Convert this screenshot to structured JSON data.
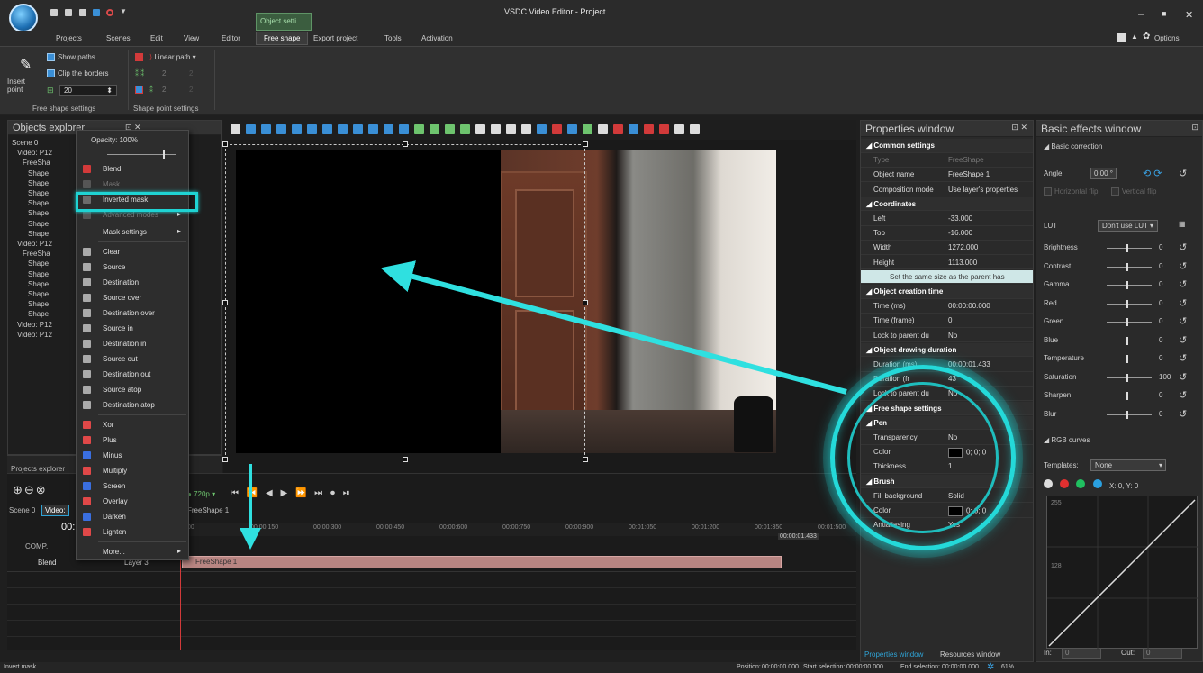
{
  "window": {
    "title": "VSDC Video Editor - Project",
    "minimize": "–",
    "maximize": "■",
    "close": "✕"
  },
  "menu": {
    "items": [
      "Projects",
      "Scenes",
      "Edit",
      "View",
      "Editor",
      "Free shape",
      "Export project",
      "Tools",
      "Activation"
    ],
    "active": "Free shape",
    "context_tab": "Object setti...",
    "options": "Options"
  },
  "ribbon": {
    "insert_point": "Insert point",
    "show_paths": "Show paths",
    "clip_borders": "Clip the borders",
    "size_value": "20",
    "linear_path": "Linear path",
    "num2a": "2",
    "num2b": "2",
    "num2c": "2",
    "num2d": "2",
    "group1": "Free shape settings",
    "group2": "Shape point settings"
  },
  "objects_explorer": {
    "title": "Objects explorer",
    "tree": [
      "Scene 0",
      "Video: P12",
      "FreeSha",
      "Shape",
      "Shape",
      "Shape",
      "Shape",
      "Shape",
      "Shape",
      "Shape",
      "Video: P12",
      "FreeSha",
      "Shape",
      "Shape",
      "Shape",
      "Shape",
      "Shape",
      "Shape",
      "Video: P12",
      "Video: P12"
    ]
  },
  "context_menu": {
    "opacity": "Opacity: 100%",
    "items": [
      {
        "label": "Blend",
        "icon": "blend-icon",
        "color": "#d23a3a"
      },
      {
        "label": "Mask",
        "icon": "mask-icon",
        "color": "#555555",
        "disabled": true
      },
      {
        "label": "Inverted mask",
        "icon": "inverted-mask-icon",
        "color": "#6c6c6c"
      },
      {
        "label": "Advanced modes",
        "icon": "advanced-icon",
        "color": "#555555",
        "disabled": true
      },
      {
        "label": "Mask settings",
        "icon": "",
        "color": ""
      },
      {
        "label": "Clear",
        "icon": "clear-icon",
        "color": "#aaaaaa"
      },
      {
        "label": "Source",
        "icon": "source-icon",
        "color": "#aaaaaa"
      },
      {
        "label": "Destination",
        "icon": "destination-icon",
        "color": "#aaaaaa"
      },
      {
        "label": "Source over",
        "icon": "source-over-icon",
        "color": "#aaaaaa"
      },
      {
        "label": "Destination over",
        "icon": "destination-over-icon",
        "color": "#aaaaaa"
      },
      {
        "label": "Source in",
        "icon": "source-in-icon",
        "color": "#aaaaaa"
      },
      {
        "label": "Destination in",
        "icon": "destination-in-icon",
        "color": "#aaaaaa"
      },
      {
        "label": "Source out",
        "icon": "source-out-icon",
        "color": "#aaaaaa"
      },
      {
        "label": "Destination out",
        "icon": "destination-out-icon",
        "color": "#aaaaaa"
      },
      {
        "label": "Source atop",
        "icon": "source-atop-icon",
        "color": "#aaaaaa"
      },
      {
        "label": "Destination atop",
        "icon": "destination-atop-icon",
        "color": "#aaaaaa"
      },
      {
        "label": "Xor",
        "icon": "xor-icon",
        "color": "#e04848"
      },
      {
        "label": "Plus",
        "icon": "plus-icon",
        "color": "#e04848"
      },
      {
        "label": "Minus",
        "icon": "minus-icon",
        "color": "#3a6fe0"
      },
      {
        "label": "Multiply",
        "icon": "multiply-icon",
        "color": "#e04848"
      },
      {
        "label": "Screen",
        "icon": "screen-icon",
        "color": "#3a6fe0"
      },
      {
        "label": "Overlay",
        "icon": "overlay-icon",
        "color": "#e04848"
      },
      {
        "label": "Darken",
        "icon": "darken-icon",
        "color": "#3a6fe0"
      },
      {
        "label": "Lighten",
        "icon": "lighten-icon",
        "color": "#e04848"
      },
      {
        "label": "More...",
        "icon": "",
        "color": ""
      }
    ]
  },
  "bottom_left": {
    "projects_explorer": "Projects explorer",
    "scene_tab": "Scene 0",
    "video_tab": "Video:",
    "time": "00:",
    "comp": "COMP.",
    "blend": "Blend",
    "layer": "Layer 3"
  },
  "player": {
    "resolution": "720p",
    "shape_tab": "FreeShape 1"
  },
  "ruler": {
    "ticks": [
      "00",
      "00:00:150",
      "00:00:300",
      "00:00:450",
      "00:00:600",
      "00:00:750",
      "00:00:900",
      "00:01:050",
      "00:01:200",
      "00:01:350",
      "00:01:500"
    ],
    "end": "00:00:01.433"
  },
  "clip": {
    "label": "FreeShape 1"
  },
  "properties": {
    "title": "Properties window",
    "rows": [
      {
        "k": "Common settings",
        "v": "",
        "sec": true
      },
      {
        "k": "Type",
        "v": "FreeShape",
        "dim": true
      },
      {
        "k": "Object name",
        "v": "FreeShape 1"
      },
      {
        "k": "Composition mode",
        "v": "Use layer's properties"
      },
      {
        "k": "Coordinates",
        "v": "",
        "sec": true
      },
      {
        "k": "Left",
        "v": "-33.000"
      },
      {
        "k": "Top",
        "v": "-16.000"
      },
      {
        "k": "Width",
        "v": "1272.000"
      },
      {
        "k": "Height",
        "v": "1113.000"
      },
      {
        "k": "Set the same size as the parent has",
        "v": "",
        "btn": true
      },
      {
        "k": "Object creation time",
        "v": "",
        "sec": true
      },
      {
        "k": "Time (ms)",
        "v": "00:00:00.000"
      },
      {
        "k": "Time (frame)",
        "v": "0"
      },
      {
        "k": "Lock to parent du",
        "v": "No"
      },
      {
        "k": "Object drawing duration",
        "v": "",
        "sec": true
      },
      {
        "k": "Duration (ms)",
        "v": "00:00:01.433"
      },
      {
        "k": "Duration (fr",
        "v": "43"
      },
      {
        "k": "Lock to parent du",
        "v": "No"
      },
      {
        "k": "Free shape settings",
        "v": "",
        "sec": true
      },
      {
        "k": "Pen",
        "v": "",
        "sec": true
      },
      {
        "k": "Transparency",
        "v": "No"
      },
      {
        "k": "Color",
        "v": "0; 0; 0",
        "swatch": true
      },
      {
        "k": "Thickness",
        "v": "1"
      },
      {
        "k": "Brush",
        "v": "",
        "sec": true
      },
      {
        "k": "Fill background",
        "v": "Solid"
      },
      {
        "k": "Color",
        "v": "0; 0; 0",
        "swatch": true
      },
      {
        "k": "Antialiasing",
        "v": "Yes"
      }
    ],
    "tab1": "Properties window",
    "tab2": "Resources window"
  },
  "effects": {
    "title": "Basic effects window",
    "basic_correction": "Basic correction",
    "angle_label": "Angle",
    "angle_value": "0.00 °",
    "hflip": "Horizontal flip",
    "vflip": "Vertical flip",
    "lut_label": "LUT",
    "lut_value": "Don't use LUT",
    "rows": [
      {
        "label": "Brightness",
        "value": "0"
      },
      {
        "label": "Contrast",
        "value": "0"
      },
      {
        "label": "Gamma",
        "value": "0"
      },
      {
        "label": "Red",
        "value": "0"
      },
      {
        "label": "Green",
        "value": "0"
      },
      {
        "label": "Blue",
        "value": "0"
      },
      {
        "label": "Temperature",
        "value": "0"
      },
      {
        "label": "Saturation",
        "value": "100"
      },
      {
        "label": "Sharpen",
        "value": "0"
      },
      {
        "label": "Blur",
        "value": "0"
      }
    ],
    "rgb_curves": "RGB curves",
    "templates_label": "Templates:",
    "templates_value": "None",
    "xy": "X: 0, Y: 0",
    "curve_top": "255",
    "curve_mid": "128",
    "in_label": "In:",
    "in_value": "0",
    "out_label": "Out:",
    "out_value": "0"
  },
  "status": {
    "left": "Invert mask",
    "position_label": "Position:",
    "position": "00:00:00.000",
    "start_label": "Start selection:",
    "start": "00:00:00.000",
    "end_label": "End selection:",
    "end": "00:00:00.000",
    "zoom": "61%"
  }
}
